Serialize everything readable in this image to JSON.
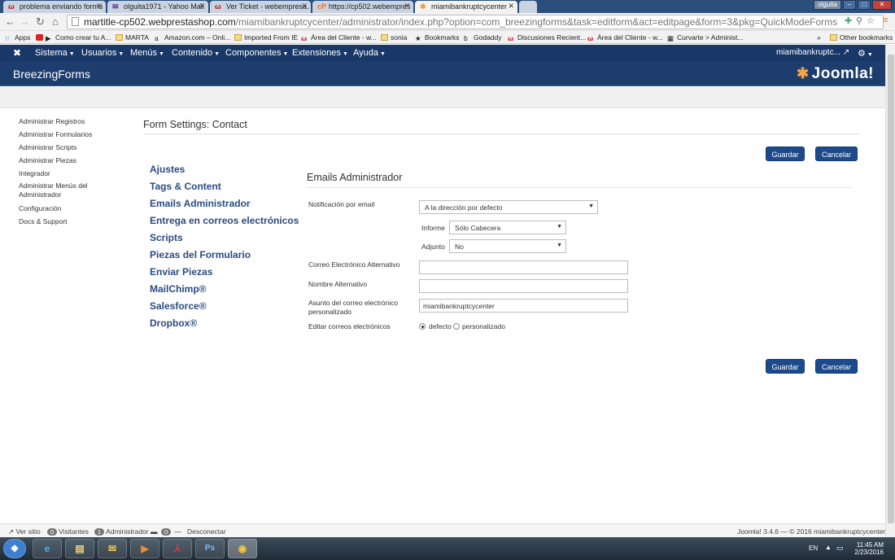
{
  "browser": {
    "tabs": [
      {
        "label": "problema enviando formu",
        "icon": "webempresa-icon"
      },
      {
        "label": "olguita1971 - Yahoo Mail",
        "icon": "yahoo-mail-icon"
      },
      {
        "label": "Ver Ticket - webempresa.",
        "icon": "webempresa-icon"
      },
      {
        "label": "https://cp502.webempres",
        "icon": "cpanel-icon"
      },
      {
        "label": "miamibankruptcycenter -",
        "icon": "joomla-icon"
      }
    ],
    "user": "olguita",
    "url_host": "martitle-cp502.webprestashop.com",
    "url_path": "/miamibankruptcycenter/administrator/index.php?option=com_breezingforms&task=editform&act=editpage&form=3&pkg=QuickModeForms",
    "bookmarks": [
      "Apps",
      "Como crear tu A...",
      "MARTA",
      "Amazon.com – Onli...",
      "Imported From IE",
      "Área del Cliente - w...",
      "sonia",
      "Bookmarks",
      "Godaddy",
      "Discusiones Recient...",
      "Área del Cliente - w...",
      "Curvarte > Administ..."
    ],
    "other_bookmarks": "Other bookmarks"
  },
  "admin": {
    "menu": [
      "Sistema",
      "Usuarios",
      "Menús",
      "Contenido",
      "Componentes",
      "Extensiones",
      "Ayuda"
    ],
    "user_link": "miamibankruptc...",
    "component_title": "BreezingForms",
    "logo_text": "Joomla!"
  },
  "sidebar": [
    "Administrar Registros",
    "Administrar Formularios",
    "Administrar Scripts",
    "Administrar Piezas",
    "Integrador",
    "Administrar Menús del Administrador",
    "Configuración",
    "Docs & Support"
  ],
  "main": {
    "page_title": "Form Settings: Contact",
    "save_label": "Guardar",
    "cancel_label": "Cancelar",
    "settings_nav": [
      "Ajustes",
      "Tags & Content",
      "Emails Administrador",
      "Entrega en correos electrónicos",
      "Scripts",
      "Piezas del Formulario",
      "Enviar Piezas",
      "MailChimp®",
      "Salesforce®",
      "Dropbox®"
    ],
    "section_title": "Emails Administrador",
    "fields": {
      "notif_label": "Notificación por email",
      "notif_value": "A la dirección por defecto",
      "informe_label": "Informe",
      "informe_value": "Sólo Cabecera",
      "adjunto_label": "Adjunto",
      "adjunto_value": "No",
      "alt_email_label": "Correo Electrónico Alternativo",
      "alt_email_value": "",
      "alt_name_label": "Nombre Alternativo",
      "alt_name_value": "",
      "subject_label": "Asunto del correo electrónico personalizado",
      "subject_value": "miamibankruptcycenter",
      "edit_label": "Editar correos electrónicos",
      "edit_options": [
        "defecto",
        "personalizado"
      ],
      "edit_selected": "defecto"
    }
  },
  "footer": {
    "view_site": "Ver sitio",
    "visitors_count": "0",
    "visitors_label": "Visitantes",
    "admins_count": "1",
    "admins_label": "Administrador",
    "messages_count": "0",
    "logout": "Desconectar",
    "version": "Joomla! 3.4.6 — © 2016 miamibankruptcycenter"
  },
  "taskbar": {
    "lang": "EN",
    "time": "11:45 AM",
    "date": "2/23/2016"
  }
}
